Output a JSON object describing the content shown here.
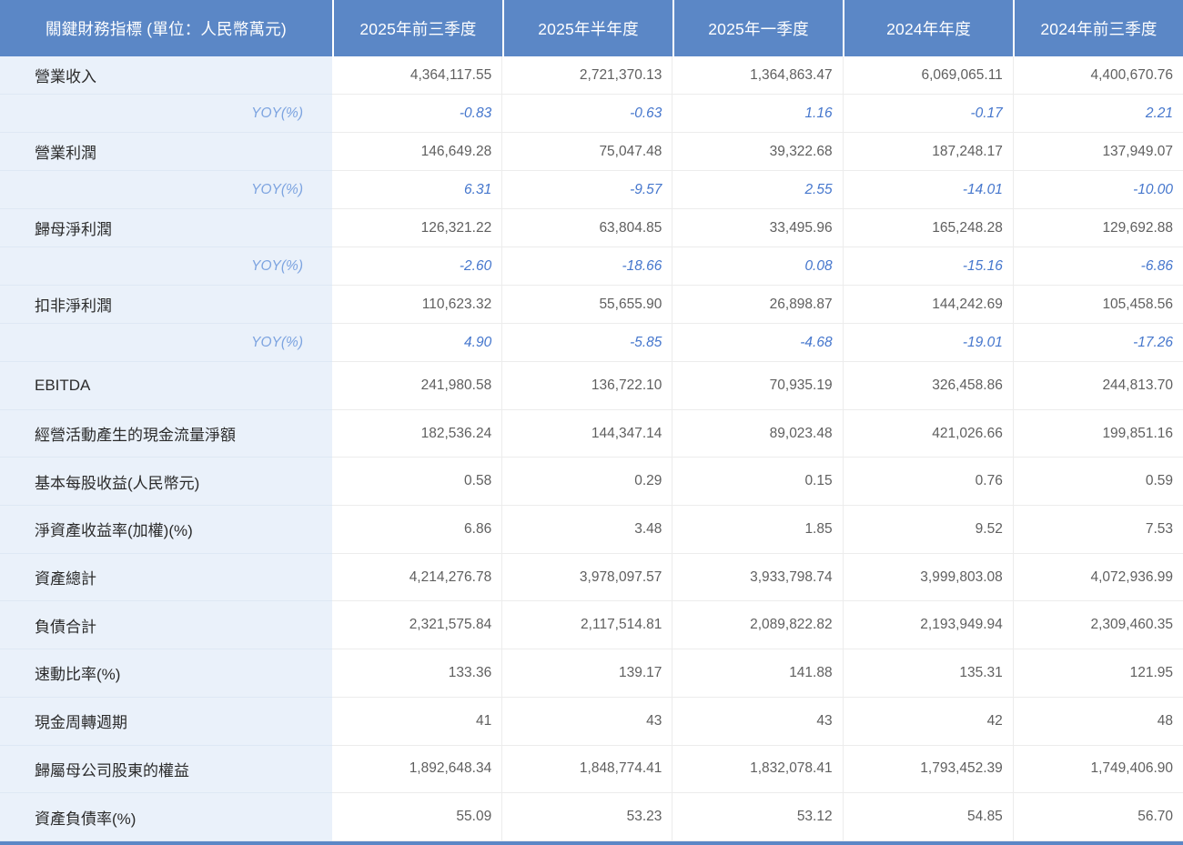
{
  "colors": {
    "header_bg": "#5b87c6",
    "label_column_bg": "#eaf1fa",
    "yoy_label": "#7da4e0",
    "yoy_value": "#4677cd",
    "value_text": "#5f5f5f"
  },
  "table": {
    "unit_header": "關鍵財務指標 (單位：人民幣萬元)",
    "columns": [
      "2025年前三季度",
      "2025年半年度",
      "2025年一季度",
      "2024年年度",
      "2024年前三季度"
    ],
    "rows": [
      {
        "label": "營業收入",
        "type": "metric",
        "values": [
          "4,364,117.55",
          "2,721,370.13",
          "1,364,863.47",
          "6,069,065.11",
          "4,400,670.76"
        ]
      },
      {
        "label": "YOY(%)",
        "type": "yoy",
        "values": [
          "-0.83",
          "-0.63",
          "1.16",
          "-0.17",
          "2.21"
        ]
      },
      {
        "label": "營業利潤",
        "type": "metric",
        "values": [
          "146,649.28",
          "75,047.48",
          "39,322.68",
          "187,248.17",
          "137,949.07"
        ]
      },
      {
        "label": "YOY(%)",
        "type": "yoy",
        "values": [
          "6.31",
          "-9.57",
          "2.55",
          "-14.01",
          "-10.00"
        ]
      },
      {
        "label": "歸母淨利潤",
        "type": "metric",
        "values": [
          "126,321.22",
          "63,804.85",
          "33,495.96",
          "165,248.28",
          "129,692.88"
        ]
      },
      {
        "label": "YOY(%)",
        "type": "yoy",
        "values": [
          "-2.60",
          "-18.66",
          "0.08",
          "-15.16",
          "-6.86"
        ]
      },
      {
        "label": "扣非淨利潤",
        "type": "metric",
        "values": [
          "110,623.32",
          "55,655.90",
          "26,898.87",
          "144,242.69",
          "105,458.56"
        ]
      },
      {
        "label": "YOY(%)",
        "type": "yoy",
        "values": [
          "4.90",
          "-5.85",
          "-4.68",
          "-19.01",
          "-17.26"
        ]
      },
      {
        "label": "EBITDA",
        "type": "metric",
        "values": [
          "241,980.58",
          "136,722.10",
          "70,935.19",
          "326,458.86",
          "244,813.70"
        ]
      },
      {
        "label": "經營活動產生的現金流量淨額",
        "type": "metric",
        "values": [
          "182,536.24",
          "144,347.14",
          "89,023.48",
          "421,026.66",
          "199,851.16"
        ]
      },
      {
        "label": "基本每股收益(人民幣元)",
        "type": "metric",
        "values": [
          "0.58",
          "0.29",
          "0.15",
          "0.76",
          "0.59"
        ]
      },
      {
        "label": "淨資產收益率(加權)(%)",
        "type": "metric",
        "values": [
          "6.86",
          "3.48",
          "1.85",
          "9.52",
          "7.53"
        ]
      },
      {
        "label": "資產總計",
        "type": "metric",
        "values": [
          "4,214,276.78",
          "3,978,097.57",
          "3,933,798.74",
          "3,999,803.08",
          "4,072,936.99"
        ]
      },
      {
        "label": "負債合計",
        "type": "metric",
        "values": [
          "2,321,575.84",
          "2,117,514.81",
          "2,089,822.82",
          "2,193,949.94",
          "2,309,460.35"
        ]
      },
      {
        "label": "速動比率(%)",
        "type": "metric",
        "values": [
          "133.36",
          "139.17",
          "141.88",
          "135.31",
          "121.95"
        ]
      },
      {
        "label": "現金周轉週期",
        "type": "metric",
        "values": [
          "41",
          "43",
          "43",
          "42",
          "48"
        ]
      },
      {
        "label": "歸屬母公司股東的權益",
        "type": "metric",
        "values": [
          "1,892,648.34",
          "1,848,774.41",
          "1,832,078.41",
          "1,793,452.39",
          "1,749,406.90"
        ]
      },
      {
        "label": "資產負債率(%)",
        "type": "metric",
        "values": [
          "55.09",
          "53.23",
          "53.12",
          "54.85",
          "56.70"
        ]
      }
    ]
  }
}
